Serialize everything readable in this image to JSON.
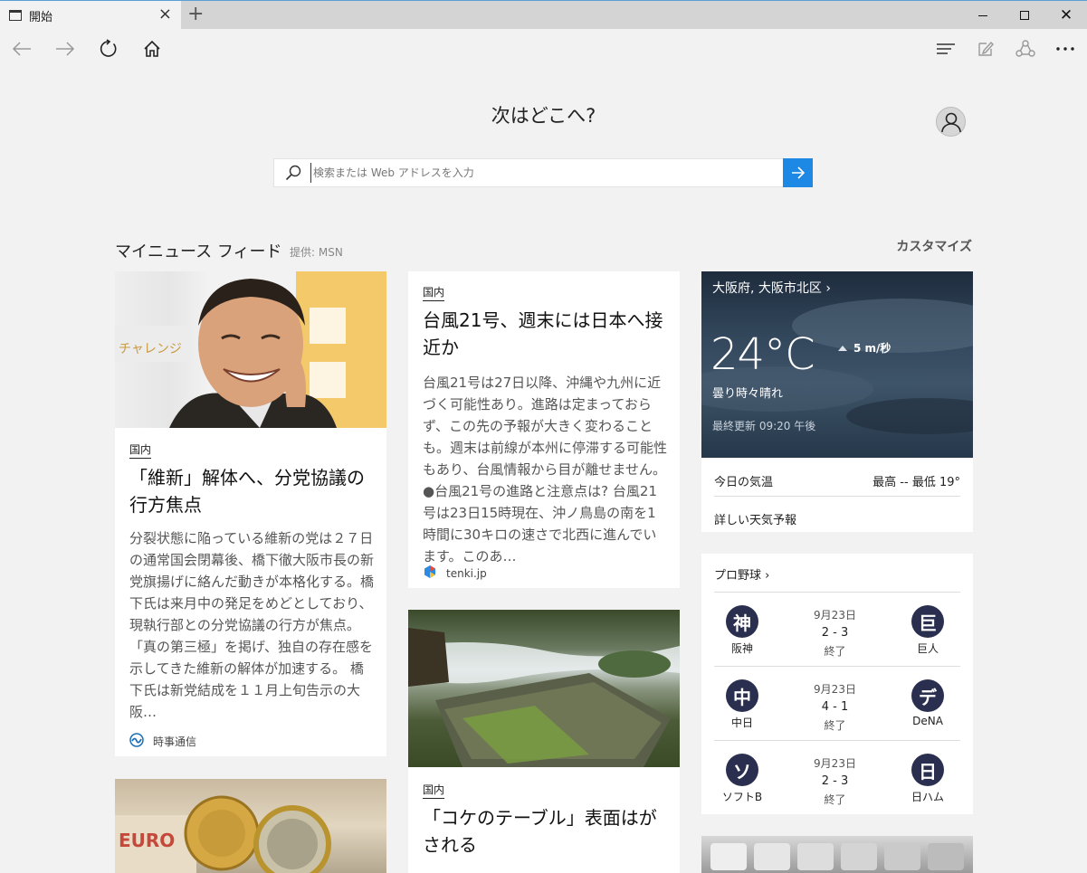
{
  "tab": {
    "title": "開始"
  },
  "page": {
    "heading": "次はどこへ?",
    "search_placeholder": "検索または Web アドレスを入力"
  },
  "feed": {
    "title": "マイニュース フィード",
    "provider": "提供: MSN",
    "customize": "カスタマイズ",
    "articles": [
      {
        "category": "国内",
        "headline": "「維新」解体へ、分党協議の行方焦点",
        "excerpt": "分裂状態に陥っている維新の党は２７日の通常国会閉幕後、橋下徹大阪市長の新党旗揚げに絡んだ動きが本格化する。橋下氏は来月中の発足をめどとしており、現執行部との分党協議の行方が焦点。「真の第三極」を掲げ、独自の存在感を示してきた維新の解体が加速する。 橋下氏は新党結成を１１月上旬告示の大阪…",
        "source": "時事通信",
        "image": "portrait-smiling-man"
      },
      {
        "category": "国内",
        "headline": "台風21号、週末には日本へ接近か",
        "excerpt": "台風21号は27日以降、沖縄や九州に近づく可能性あり。進路は定まっておらず、この先の予報が大きく変わることも。週末は前線が本州に停滞する可能性もあり、台風情報から目が離せません。 ●台風21号の進路と注意点は? 台風21号は23日15時現在、沖ノ鳥島の南を1時間に30キロの速さで北西に進んでいます。このあ…",
        "source": "tenki.jp"
      },
      {
        "category": "国内",
        "headline": "「コケのテーブル」表面はがされる",
        "image": "moss-table-river"
      },
      {
        "image": "euro-coins"
      }
    ]
  },
  "weather": {
    "location": "大阪府, 大阪市北区",
    "temp": "24°C",
    "wind": "5 m/秒",
    "condition": "曇り時々晴れ",
    "updated": "最終更新 09:20 午後",
    "today_label": "今日の気温",
    "high_low": "最高 --  最低 19°",
    "forecast_link": "詳しい天気予報"
  },
  "baseball": {
    "title": "プロ野球",
    "games": [
      {
        "date": "9月23日",
        "score": "2 - 3",
        "status": "終了",
        "left_badge": "神",
        "left_name": "阪神",
        "right_badge": "巨",
        "right_name": "巨人"
      },
      {
        "date": "9月23日",
        "score": "4 - 1",
        "status": "終了",
        "left_badge": "中",
        "left_name": "中日",
        "right_badge": "デ",
        "right_name": "DeNA"
      },
      {
        "date": "9月23日",
        "score": "2 - 3",
        "status": "終了",
        "left_badge": "ソ",
        "left_name": "ソフトB",
        "right_badge": "日",
        "right_name": "日ハム"
      }
    ]
  }
}
